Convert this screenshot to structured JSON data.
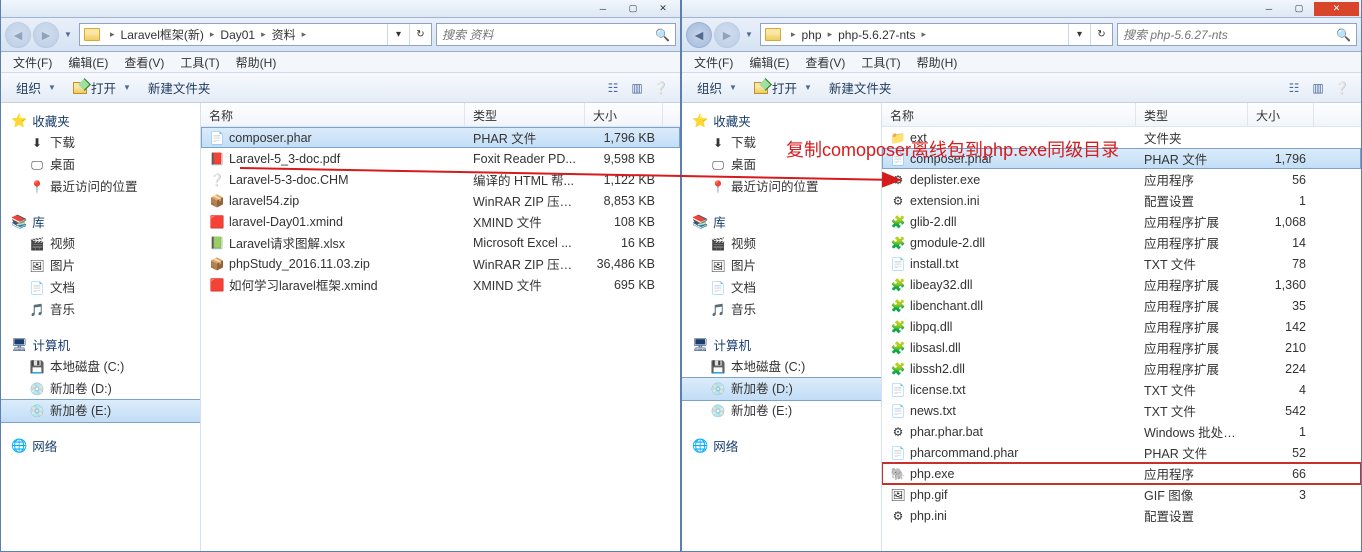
{
  "annotation": "复制comoposer离线包到php.exe同级目录",
  "left": {
    "crumbs": [
      "Laravel框架(新)",
      "Day01",
      "资料"
    ],
    "search_ph": "搜索 资料",
    "menu": [
      "文件(F)",
      "编辑(E)",
      "查看(V)",
      "工具(T)",
      "帮助(H)"
    ],
    "toolbar": {
      "org": "组织",
      "open": "打开",
      "newf": "新建文件夹"
    },
    "cols": {
      "name": "名称",
      "type": "类型",
      "size": "大小",
      "w_name": 264,
      "w_type": 120,
      "w_size": 78
    },
    "nav": {
      "fav": "收藏夹",
      "dl": "下载",
      "desk": "桌面",
      "recent": "最近访问的位置",
      "lib": "库",
      "video": "视频",
      "pic": "图片",
      "doc": "文档",
      "music": "音乐",
      "comp": "计算机",
      "c": "本地磁盘 (C:)",
      "d": "新加卷 (D:)",
      "e": "新加卷 (E:)",
      "net": "网络"
    },
    "files": [
      {
        "n": "composer.phar",
        "t": "PHAR 文件",
        "s": "1,796 KB",
        "i": "📄",
        "sel": true
      },
      {
        "n": "Laravel-5_3-doc.pdf",
        "t": "Foxit Reader PD...",
        "s": "9,598 KB",
        "i": "📕"
      },
      {
        "n": "Laravel-5-3-doc.CHM",
        "t": "编译的 HTML 帮...",
        "s": "1,122 KB",
        "i": "❔"
      },
      {
        "n": "laravel54.zip",
        "t": "WinRAR ZIP 压缩...",
        "s": "8,853 KB",
        "i": "📦"
      },
      {
        "n": "laravel-Day01.xmind",
        "t": "XMIND 文件",
        "s": "108 KB",
        "i": "🟥"
      },
      {
        "n": "Laravel请求图解.xlsx",
        "t": "Microsoft Excel ...",
        "s": "16 KB",
        "i": "📗"
      },
      {
        "n": "phpStudy_2016.11.03.zip",
        "t": "WinRAR ZIP 压缩...",
        "s": "36,486 KB",
        "i": "📦"
      },
      {
        "n": "如何学习laravel框架.xmind",
        "t": "XMIND 文件",
        "s": "695 KB",
        "i": "🟥"
      }
    ]
  },
  "right": {
    "crumbs": [
      "php",
      "php-5.6.27-nts"
    ],
    "search_ph": "搜索 php-5.6.27-nts",
    "menu": [
      "文件(F)",
      "编辑(E)",
      "查看(V)",
      "工具(T)",
      "帮助(H)"
    ],
    "toolbar": {
      "org": "组织",
      "open": "打开",
      "newf": "新建文件夹"
    },
    "cols": {
      "name": "名称",
      "type": "类型",
      "size": "大小",
      "w_name": 254,
      "w_type": 112,
      "w_size": 66
    },
    "nav": {
      "fav": "收藏夹",
      "dl": "下载",
      "desk": "桌面",
      "recent": "最近访问的位置",
      "lib": "库",
      "video": "视频",
      "pic": "图片",
      "doc": "文档",
      "music": "音乐",
      "comp": "计算机",
      "c": "本地磁盘 (C:)",
      "d": "新加卷 (D:)",
      "e": "新加卷 (E:)",
      "net": "网络"
    },
    "files": [
      {
        "n": "ext",
        "t": "文件夹",
        "s": "",
        "i": "📁"
      },
      {
        "n": "composer.phar",
        "t": "PHAR 文件",
        "s": "1,796",
        "i": "📄",
        "sel": true
      },
      {
        "n": "deplister.exe",
        "t": "应用程序",
        "s": "56",
        "i": "⚙"
      },
      {
        "n": "extension.ini",
        "t": "配置设置",
        "s": "1",
        "i": "⚙"
      },
      {
        "n": "glib-2.dll",
        "t": "应用程序扩展",
        "s": "1,068",
        "i": "🧩"
      },
      {
        "n": "gmodule-2.dll",
        "t": "应用程序扩展",
        "s": "14",
        "i": "🧩"
      },
      {
        "n": "install.txt",
        "t": "TXT 文件",
        "s": "78",
        "i": "📄"
      },
      {
        "n": "libeay32.dll",
        "t": "应用程序扩展",
        "s": "1,360",
        "i": "🧩"
      },
      {
        "n": "libenchant.dll",
        "t": "应用程序扩展",
        "s": "35",
        "i": "🧩"
      },
      {
        "n": "libpq.dll",
        "t": "应用程序扩展",
        "s": "142",
        "i": "🧩"
      },
      {
        "n": "libsasl.dll",
        "t": "应用程序扩展",
        "s": "210",
        "i": "🧩"
      },
      {
        "n": "libssh2.dll",
        "t": "应用程序扩展",
        "s": "224",
        "i": "🧩"
      },
      {
        "n": "license.txt",
        "t": "TXT 文件",
        "s": "4",
        "i": "📄"
      },
      {
        "n": "news.txt",
        "t": "TXT 文件",
        "s": "542",
        "i": "📄"
      },
      {
        "n": "phar.phar.bat",
        "t": "Windows 批处理...",
        "s": "1",
        "i": "⚙"
      },
      {
        "n": "pharcommand.phar",
        "t": "PHAR 文件",
        "s": "52",
        "i": "📄"
      },
      {
        "n": "php.exe",
        "t": "应用程序",
        "s": "66",
        "i": "🐘",
        "box": true
      },
      {
        "n": "php.gif",
        "t": "GIF 图像",
        "s": "3",
        "i": "🖼"
      },
      {
        "n": "php.ini",
        "t": "配置设置",
        "s": "",
        "i": "⚙"
      }
    ]
  }
}
